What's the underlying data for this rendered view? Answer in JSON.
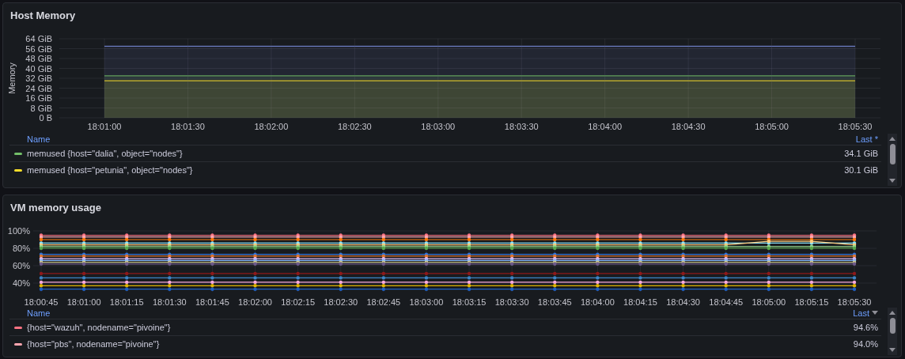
{
  "panels": [
    {
      "title": "Host Memory",
      "chart_data": {
        "type": "area",
        "ylabel": "Memory",
        "grid": true,
        "categories": [
          "18:01:00",
          "18:01:30",
          "18:02:00",
          "18:02:30",
          "18:03:00",
          "18:03:30",
          "18:04:00",
          "18:04:30",
          "18:05:00",
          "18:05:30"
        ],
        "series": [
          {
            "color": "#7b8ee0",
            "values": [
              58,
              58,
              58,
              58,
              58,
              58,
              58,
              58,
              58,
              58
            ]
          },
          {
            "color": "#73bf69",
            "values": [
              34,
              34,
              34,
              34,
              34,
              34,
              34,
              34,
              34,
              34
            ]
          },
          {
            "color": "#fade2a",
            "values": [
              30,
              30,
              30,
              30,
              30,
              30,
              30,
              30,
              30,
              30
            ]
          }
        ],
        "ylim": [
          0,
          64
        ],
        "yticks": [
          {
            "value": 0,
            "label": "0 B"
          },
          {
            "value": 8,
            "label": "8 GiB"
          },
          {
            "value": 16,
            "label": "16 GiB"
          },
          {
            "value": 24,
            "label": "24 GiB"
          },
          {
            "value": 32,
            "label": "32 GiB"
          },
          {
            "value": 40,
            "label": "40 GiB"
          },
          {
            "value": 48,
            "label": "48 GiB"
          },
          {
            "value": 56,
            "label": "56 GiB"
          },
          {
            "value": 64,
            "label": "64 GiB"
          }
        ]
      },
      "legend": {
        "columns": [
          {
            "label": "Name",
            "sorted": false
          },
          {
            "label": "Last *",
            "sorted": false
          }
        ],
        "items": [
          {
            "name": "memused {host=\"dalia\", object=\"nodes\"}",
            "color": "#73bf69",
            "last": "34.1 GiB"
          },
          {
            "name": "memused {host=\"petunia\", object=\"nodes\"}",
            "color": "#fade2a",
            "last": "30.1 GiB"
          }
        ]
      }
    },
    {
      "title": "VM memory usage",
      "chart_data": {
        "type": "line",
        "grid": true,
        "categories": [
          "18:00:45",
          "18:01:00",
          "18:01:15",
          "18:01:30",
          "18:01:45",
          "18:02:00",
          "18:02:15",
          "18:02:30",
          "18:02:45",
          "18:03:00",
          "18:03:15",
          "18:03:30",
          "18:03:45",
          "18:04:00",
          "18:04:15",
          "18:04:30",
          "18:04:45",
          "18:05:00",
          "18:05:15",
          "18:05:30"
        ],
        "series": [
          {
            "color": "#ff7383",
            "values": [
              95,
              95,
              95,
              95,
              95,
              95,
              95,
              95,
              95,
              95,
              95,
              95,
              95,
              95,
              95,
              95,
              95,
              95,
              95,
              95
            ]
          },
          {
            "color": "#ffa6b0",
            "values": [
              93,
              93,
              93,
              93,
              93,
              93,
              93,
              93,
              93,
              93,
              93,
              93,
              93,
              93,
              93,
              93,
              93,
              93,
              93,
              93
            ]
          },
          {
            "color": "#ff780a",
            "values": [
              90,
              90,
              90,
              90,
              90,
              90,
              90,
              90,
              90,
              90,
              90,
              90,
              90,
              90,
              90,
              90,
              90,
              90,
              90,
              90
            ]
          },
          {
            "color": "#8ae6ff",
            "values": [
              86,
              86,
              86,
              86,
              86,
              86,
              86,
              86,
              86,
              86,
              86,
              86,
              86,
              86,
              86,
              86,
              86,
              86,
              86,
              86
            ]
          },
          {
            "color": "#ffcb7d",
            "values": [
              84,
              84,
              84,
              84,
              84,
              84,
              84,
              84,
              84,
              84,
              84,
              84,
              84,
              84,
              84,
              84,
              84,
              88,
              88,
              84
            ]
          },
          {
            "color": "#96d98d",
            "values": [
              82,
              82,
              82,
              82,
              82,
              82,
              82,
              82,
              82,
              82,
              82,
              82,
              82,
              82,
              82,
              82,
              82,
              82,
              82,
              82
            ]
          },
          {
            "color": "#56a64b",
            "values": [
              80,
              80,
              80,
              80,
              80,
              80,
              80,
              80,
              80,
              80,
              80,
              80,
              80,
              80,
              80,
              80,
              80,
              80,
              80,
              80
            ]
          },
          {
            "color": "#3274d9",
            "values": [
              73,
              73,
              73,
              73,
              73,
              73,
              73,
              73,
              73,
              73,
              73,
              73,
              73,
              73,
              73,
              73,
              73,
              73,
              73,
              73
            ]
          },
          {
            "color": "#e0752d",
            "values": [
              71,
              71,
              71,
              71,
              71,
              71,
              71,
              71,
              71,
              71,
              71,
              71,
              71,
              71,
              71,
              71,
              71,
              71,
              71,
              71
            ]
          },
          {
            "color": "#deb6f2",
            "values": [
              68,
              68,
              68,
              68,
              68,
              68,
              68,
              68,
              68,
              68,
              68,
              68,
              68,
              68,
              68,
              68,
              68,
              68,
              68,
              68
            ]
          },
          {
            "color": "#8ab8ff",
            "values": [
              66,
              66,
              66,
              66,
              66,
              66,
              66,
              66,
              66,
              66,
              66,
              66,
              66,
              66,
              66,
              66,
              66,
              66,
              66,
              66
            ]
          },
          {
            "color": "#c8c48c",
            "values": [
              64,
              64,
              64,
              64,
              64,
              64,
              64,
              64,
              64,
              64,
              64,
              64,
              64,
              64,
              64,
              64,
              64,
              64,
              64,
              64
            ]
          },
          {
            "color": "#6d5a8a",
            "values": [
              62,
              62,
              62,
              62,
              62,
              62,
              62,
              62,
              62,
              62,
              62,
              62,
              62,
              62,
              62,
              62,
              62,
              62,
              62,
              62
            ]
          },
          {
            "color": "#8e1a1a",
            "values": [
              51,
              51,
              51,
              51,
              51,
              51,
              51,
              51,
              51,
              51,
              51,
              51,
              51,
              51,
              51,
              51,
              51,
              51,
              51,
              51
            ]
          },
          {
            "color": "#3d85c6",
            "values": [
              46,
              46,
              46,
              46,
              46,
              46,
              46,
              46,
              46,
              46,
              46,
              46,
              46,
              46,
              46,
              46,
              46,
              46,
              46,
              46
            ]
          },
          {
            "color": "#f7a8dc",
            "values": [
              41,
              41,
              41,
              41,
              41,
              41,
              41,
              41,
              41,
              41,
              41,
              41,
              41,
              41,
              41,
              41,
              41,
              41,
              41,
              41
            ]
          },
          {
            "color": "#e0b400",
            "values": [
              37,
              37,
              37,
              37,
              37,
              37,
              37,
              37,
              37,
              37,
              37,
              37,
              37,
              37,
              37,
              37,
              37,
              37,
              37,
              37
            ]
          },
          {
            "color": "#1f60c4",
            "values": [
              33,
              33,
              33,
              33,
              33,
              33,
              33,
              33,
              33,
              33,
              33,
              33,
              33,
              33,
              33,
              33,
              33,
              33,
              33,
              33
            ]
          }
        ],
        "ylim": [
          30,
          100
        ],
        "yticks": [
          {
            "value": 40,
            "label": "40%"
          },
          {
            "value": 60,
            "label": "60%"
          },
          {
            "value": 80,
            "label": "80%"
          },
          {
            "value": 100,
            "label": "100%"
          }
        ]
      },
      "legend": {
        "columns": [
          {
            "label": "Name",
            "sorted": false
          },
          {
            "label": "Last",
            "sorted": true
          }
        ],
        "items": [
          {
            "name": "{host=\"wazuh\", nodename=\"pivoine\"}",
            "color": "#ff7383",
            "last": "94.6%"
          },
          {
            "name": "{host=\"pbs\", nodename=\"pivoine\"}",
            "color": "#ffa6b0",
            "last": "94.0%"
          }
        ]
      }
    }
  ]
}
